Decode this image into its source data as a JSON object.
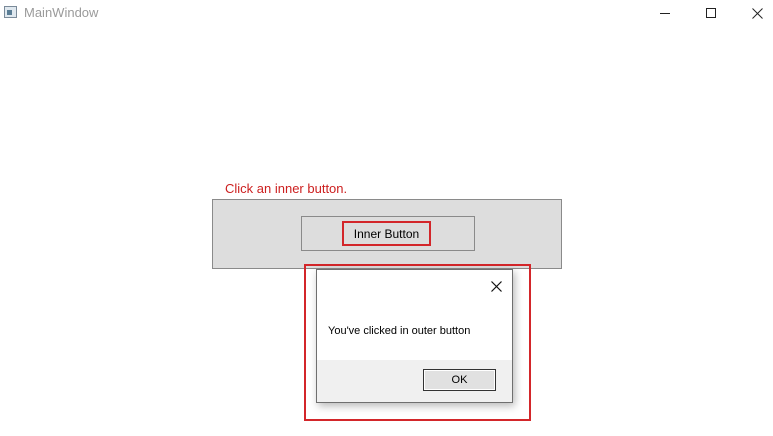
{
  "window": {
    "title": "MainWindow",
    "icon": "app-window-icon",
    "controls": {
      "minimize_icon": "minimize-icon",
      "maximize_icon": "maximize-icon",
      "close_icon": "close-icon"
    }
  },
  "content": {
    "hint_text": "Click an inner button.",
    "inner_button_label": "Inner Button"
  },
  "dialog": {
    "message": "You've clicked in outer button",
    "ok_label": "OK",
    "close_icon": "close-icon"
  },
  "colors": {
    "highlight": "#d3262a",
    "hint_text": "#cc1f1f",
    "button_face": "#dddddd"
  }
}
